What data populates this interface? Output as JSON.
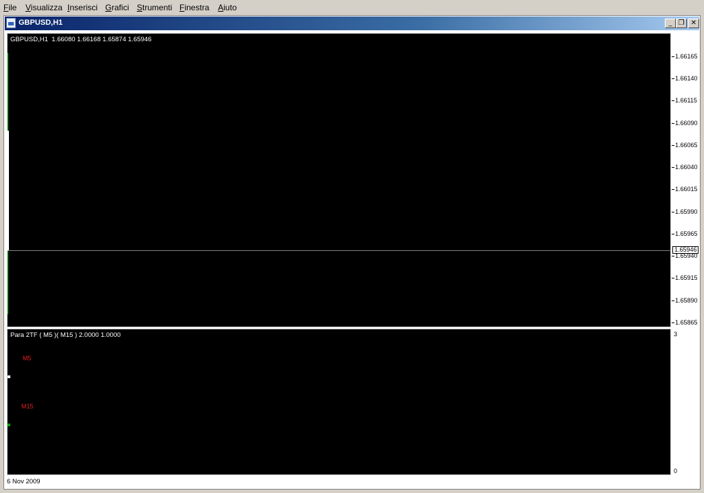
{
  "menu": {
    "items": [
      "File",
      "Visualizza",
      "Inserisci",
      "Grafici",
      "Strumenti",
      "Finestra",
      "Aiuto"
    ]
  },
  "window": {
    "title": "GBPUSD,H1",
    "minimize_icon": "minimize-icon",
    "restore_icon": "restore-icon",
    "close_icon": "close-icon"
  },
  "main_chart": {
    "header": "GBPUSD,H1  1.66080 1.66168 1.65874 1.65946",
    "symbol": "GBPUSD",
    "timeframe": "H1",
    "open": 1.6608,
    "high": 1.66168,
    "low": 1.65874,
    "close": 1.65946,
    "current_price": "1.65946",
    "price_labels": [
      "1.66165",
      "1.66140",
      "1.66115",
      "1.66090",
      "1.66065",
      "1.66040",
      "1.66015",
      "1.65990",
      "1.65965",
      "1.65940",
      "1.65915",
      "1.65890",
      "1.65865"
    ],
    "colors": {
      "background": "#000000",
      "bull_candle": "#00c800",
      "body": "#ffffff"
    }
  },
  "sub_chart": {
    "header": "Para 2TF ( M5 )( M15 ) 2.0000 1.0000",
    "label_m5": "M5",
    "label_m15": "M15",
    "scale_max": "3",
    "scale_min": "0",
    "colors": {
      "label": "#e02020",
      "m5_mark": "#ffffff",
      "m15_mark": "#00a000"
    }
  },
  "time_axis": {
    "first_date": "6 Nov 2009"
  }
}
